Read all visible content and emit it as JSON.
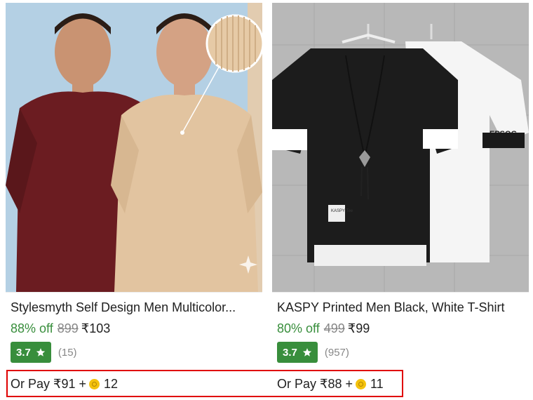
{
  "products": [
    {
      "title": "Stylesmyth Self Design Men Multicolor...",
      "discount": "88% off",
      "mrp": "899",
      "price": "₹103",
      "rating": "3.7",
      "reviews": "(15)",
      "pay_prefix": "Or Pay ₹91 +",
      "coins": "12",
      "image_alt": "two-men-tshirts-photo"
    },
    {
      "title": "KASPY Printed Men Black, White T-Shirt",
      "discount": "80% off",
      "mrp": "499",
      "price": "₹99",
      "rating": "3.7",
      "reviews": "(957)",
      "pay_prefix": "Or Pay ₹88 +",
      "coins": "11",
      "image_alt": "hanging-tshirts-photo",
      "tag_text": "KASPY Tee",
      "sleeve_text": "EPSOG"
    }
  ],
  "colors": {
    "discount_green": "#388e3c",
    "rating_badge": "#388e3c",
    "highlight_border": "#e00000",
    "muted": "#878787"
  }
}
